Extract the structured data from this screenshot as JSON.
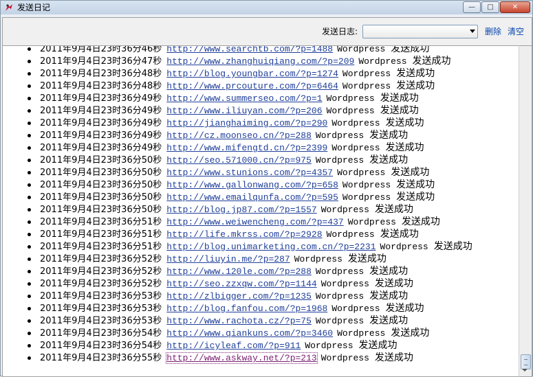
{
  "window": {
    "title": "发送日记",
    "controls": {
      "minimize": "—",
      "maximize": "□",
      "close": "✕"
    }
  },
  "toolbar": {
    "log_label": "发送日志:",
    "log_select_value": "",
    "delete_label": "删除",
    "clear_label": "清空"
  },
  "log": {
    "entries": [
      {
        "date": "2011年9月4日23时36分46秒",
        "url": "http://www.searchtb.com/?p=1488",
        "platform": "Wordpress",
        "status": "发送成功"
      },
      {
        "date": "2011年9月4日23时36分47秒",
        "url": "http://www.zhanghuiqiang.com/?p=209",
        "platform": "Wordpress",
        "status": "发送成功"
      },
      {
        "date": "2011年9月4日23时36分48秒",
        "url": "http://blog.youngbar.com/?p=1274",
        "platform": "Wordpress",
        "status": "发送成功"
      },
      {
        "date": "2011年9月4日23时36分48秒",
        "url": "http://www.prcouture.com/?p=6464",
        "platform": "Wordpress",
        "status": "发送成功"
      },
      {
        "date": "2011年9月4日23时36分49秒",
        "url": "http://www.summerseo.com/?p=1",
        "platform": "Wordpress",
        "status": "发送成功"
      },
      {
        "date": "2011年9月4日23时36分49秒",
        "url": "http://www.iliuyan.com/?p=206",
        "platform": "Wordpress",
        "status": "发送成功"
      },
      {
        "date": "2011年9月4日23时36分49秒",
        "url": "http://jianghaiming.com/?p=290",
        "platform": "Wordpress",
        "status": "发送成功"
      },
      {
        "date": "2011年9月4日23时36分49秒",
        "url": "http://cz.moonseo.cn/?p=288",
        "platform": "Wordpress",
        "status": "发送成功"
      },
      {
        "date": "2011年9月4日23时36分49秒",
        "url": "http://www.mifengtd.cn/?p=2399",
        "platform": "Wordpress",
        "status": "发送成功"
      },
      {
        "date": "2011年9月4日23时36分50秒",
        "url": "http://seo.571000.cn/?p=975",
        "platform": "Wordpress",
        "status": "发送成功"
      },
      {
        "date": "2011年9月4日23时36分50秒",
        "url": "http://www.stunions.com/?p=4357",
        "platform": "Wordpress",
        "status": "发送成功"
      },
      {
        "date": "2011年9月4日23时36分50秒",
        "url": "http://www.gallonwang.com/?p=658",
        "platform": "Wordpress",
        "status": "发送成功"
      },
      {
        "date": "2011年9月4日23时36分50秒",
        "url": "http://www.emailqunfa.com/?p=595",
        "platform": "Wordpress",
        "status": "发送成功"
      },
      {
        "date": "2011年9月4日23时36分50秒",
        "url": "http://blog.jp87.com/?p=1557",
        "platform": "Wordpress",
        "status": "发送成功"
      },
      {
        "date": "2011年9月4日23时36分51秒",
        "url": "http://www.weiwencheng.com/?p=437",
        "platform": "Wordpress",
        "status": "发送成功"
      },
      {
        "date": "2011年9月4日23时36分51秒",
        "url": "http://life.mkrss.com/?p=2928",
        "platform": "Wordpress",
        "status": "发送成功"
      },
      {
        "date": "2011年9月4日23时36分51秒",
        "url": "http://blog.unimarketing.com.cn/?p=2231",
        "platform": "Wordpress",
        "status": "发送成功"
      },
      {
        "date": "2011年9月4日23时36分52秒",
        "url": "http://liuyin.me/?p=287",
        "platform": "Wordpress",
        "status": "发送成功"
      },
      {
        "date": "2011年9月4日23时36分52秒",
        "url": "http://www.120le.com/?p=288",
        "platform": "Wordpress",
        "status": "发送成功"
      },
      {
        "date": "2011年9月4日23时36分52秒",
        "url": "http://seo.zzxqw.com/?p=1144",
        "platform": "Wordpress",
        "status": "发送成功"
      },
      {
        "date": "2011年9月4日23时36分53秒",
        "url": "http://zlbigger.com/?p=1235",
        "platform": "Wordpress",
        "status": "发送成功"
      },
      {
        "date": "2011年9月4日23时36分53秒",
        "url": "http://blog.fanfou.com/?p=1968",
        "platform": "Wordpress",
        "status": "发送成功"
      },
      {
        "date": "2011年9月4日23时36分53秒",
        "url": "http://www.rachota.cz/?p=75",
        "platform": "Wordpress",
        "status": "发送成功"
      },
      {
        "date": "2011年9月4日23时36分54秒",
        "url": "http://www.qiankuns.com/?p=3460",
        "platform": "Wordpress",
        "status": "发送成功"
      },
      {
        "date": "2011年9月4日23时36分54秒",
        "url": "http://icyleaf.com/?p=911",
        "platform": "Wordpress",
        "status": "发送成功"
      },
      {
        "date": "2011年9月4日23时36分55秒",
        "url": "http://www.askway.net/?p=213",
        "platform": "Wordpress",
        "status": "发送成功",
        "visited": true
      }
    ]
  },
  "colors": {
    "link": "#1f3f9a",
    "visited_link": "#7a1f73"
  },
  "icons": {
    "app": "app-icon",
    "combo": "chevron-down-icon",
    "scroll_down": "arrow-down-icon"
  }
}
